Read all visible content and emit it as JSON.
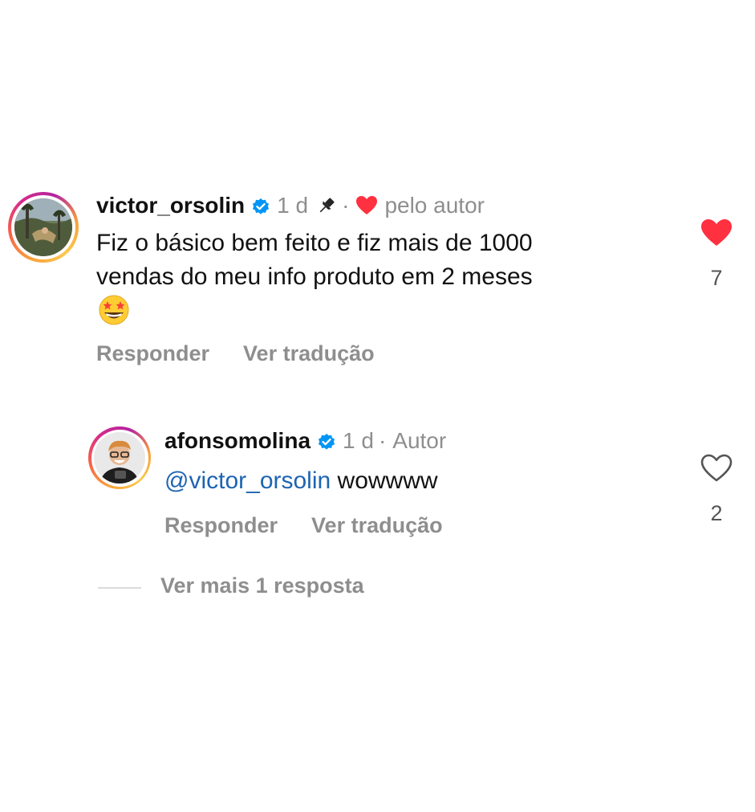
{
  "comments": [
    {
      "username": "victor_orsolin",
      "time": "1 d",
      "separator": "·",
      "liked_by_author_label": "pelo autor",
      "text_line1": "Fiz o básico bem feito e fiz mais de 1000",
      "text_line2": "vendas do meu info produto em 2 meses",
      "emoji": "star-struck-emoji",
      "like_count": "7",
      "liked": true,
      "reply_label": "Responder",
      "translate_label": "Ver tradução"
    },
    {
      "username": "afonsomolina",
      "time": "1 d",
      "separator": "·",
      "author_label": "Autor",
      "mention": "@victor_orsolin",
      "text": "wowwww",
      "like_count": "2",
      "liked": false,
      "reply_label": "Responder",
      "translate_label": "Ver tradução"
    }
  ],
  "more_replies_label": "Ver mais 1 resposta",
  "colors": {
    "heart_red": "#ff3040",
    "verified_blue": "#0095f6",
    "mention_blue": "#1d64b2",
    "secondary_text": "#8e8e8e"
  }
}
